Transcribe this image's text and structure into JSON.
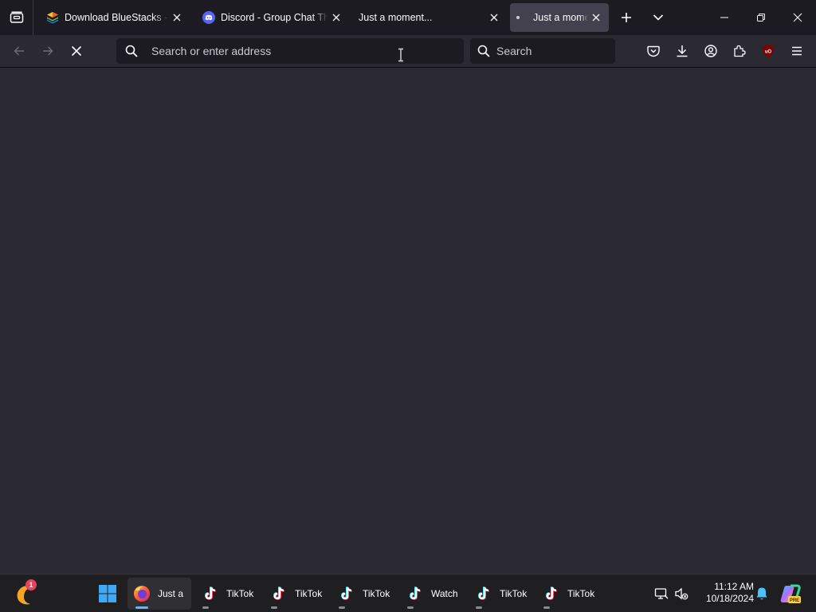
{
  "browser": {
    "tabs": [
      {
        "title": "Download BlueStacks - App Player",
        "favicon": "bluestacks-icon",
        "active": false
      },
      {
        "title": "Discord - Group Chat That’s All Fun & Games",
        "favicon": "discord-icon",
        "active": false
      },
      {
        "title": "Just a moment...",
        "favicon": "none",
        "active": false
      },
      {
        "title": "Just a moment...",
        "favicon": "loading-dot-icon",
        "active": true
      }
    ],
    "new_tab_icon": "plus-icon",
    "list_all_tabs_icon": "chevron-down-icon",
    "window_controls": [
      "minimize-icon",
      "restore-icon",
      "close-icon"
    ]
  },
  "navbar": {
    "back_icon": "back-arrow-icon",
    "forward_icon": "forward-arrow-icon",
    "stop_icon": "stop-loading-icon",
    "url_placeholder": "Search or enter address",
    "search_placeholder": "Search",
    "toolbar_icons": [
      "pocket-icon",
      "downloads-icon",
      "account-icon",
      "extensions-icon",
      "ublock-origin-icon",
      "menu-icon"
    ]
  },
  "taskbar": {
    "widget_badge": "1",
    "items": [
      {
        "label": "Just a",
        "icon": "firefox-icon",
        "active": true
      },
      {
        "label": "TikTok",
        "icon": "tiktok-icon",
        "active": false
      },
      {
        "label": "TikTok",
        "icon": "tiktok-icon",
        "active": false
      },
      {
        "label": "TikTok",
        "icon": "tiktok-icon",
        "active": false
      },
      {
        "label": "Watch",
        "icon": "tiktok-icon",
        "active": false
      },
      {
        "label": "TikTok",
        "icon": "tiktok-icon",
        "active": false
      },
      {
        "label": "TikTok",
        "icon": "tiktok-icon",
        "active": false
      }
    ],
    "clock": {
      "time": "11:12 AM",
      "date": "10/18/2024"
    }
  },
  "colors": {
    "tabstrip_bg": "#1c1b22",
    "toolbar_bg": "#2b2a33",
    "active_tab_bg": "#42414d",
    "urlbar_bg": "#1c1b22",
    "taskbar_bg": "#1f1f22",
    "accent": "#4cc2ff"
  }
}
